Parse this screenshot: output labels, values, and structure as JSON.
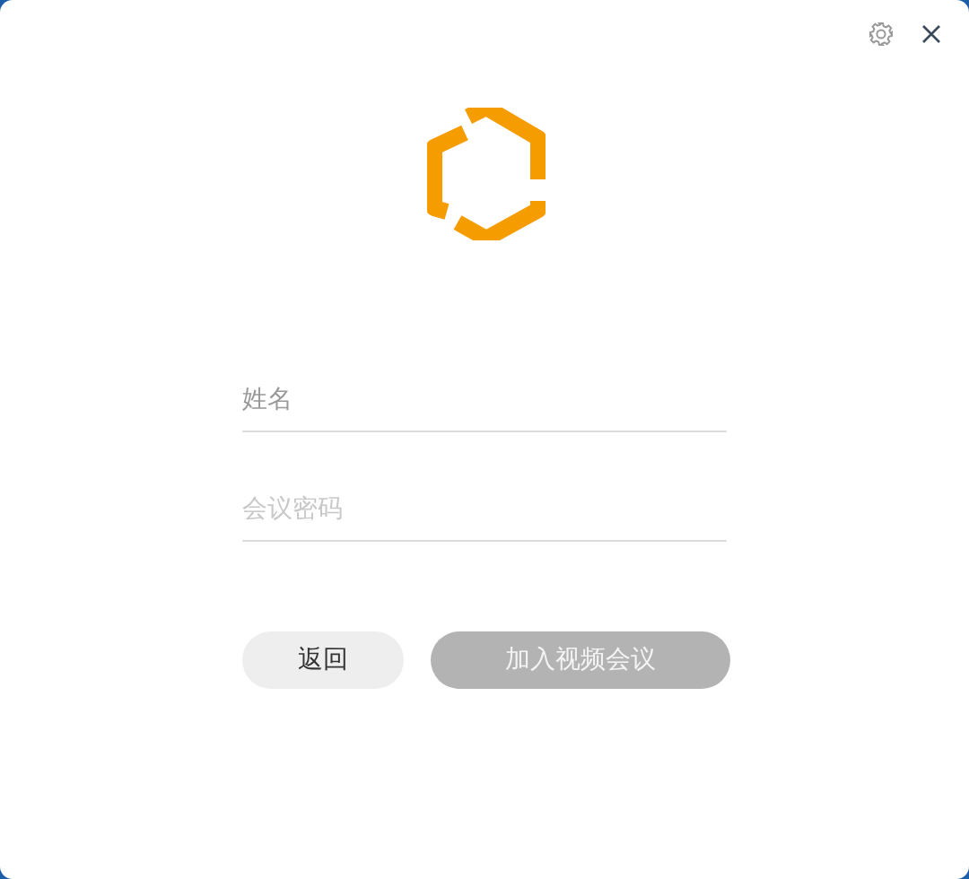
{
  "fields": [
    {
      "placeholder": "姓名",
      "focused": true
    },
    {
      "placeholder": "会议密码",
      "focused": false
    }
  ],
  "buttons": [
    {
      "kind": "secondary",
      "label": "返回",
      "disabled": false
    },
    {
      "kind": "primary",
      "label": "加入视频会议",
      "disabled": true
    }
  ]
}
